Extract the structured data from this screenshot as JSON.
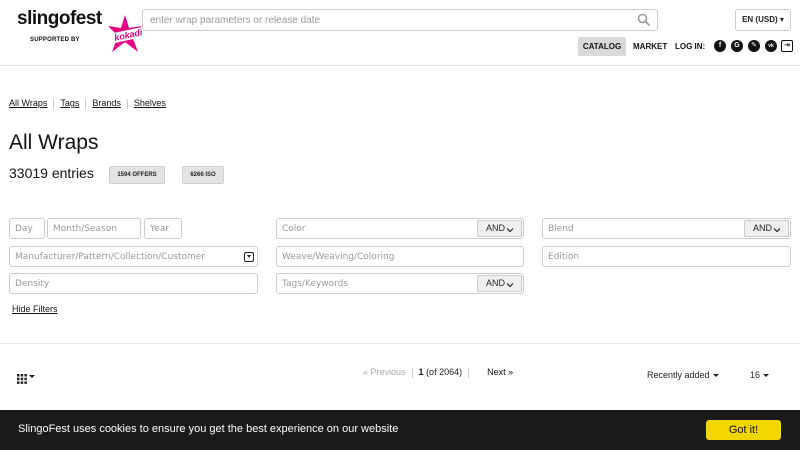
{
  "header": {
    "logo_text": "slingofest",
    "logo_subtitle": "SUPPORTED BY",
    "logo_brand": "kokadi",
    "search_placeholder": "enter wrap parameters or release date",
    "language": "EN (USD) ▾",
    "nav": {
      "catalog": "CATALOG",
      "market": "MARKET",
      "login": "LOG IN:"
    },
    "social_icons": [
      "facebook-icon",
      "google-icon",
      "vk-icon",
      "vk-icon",
      "login-box-icon"
    ],
    "social_glyphs": [
      "f",
      "G",
      "✎",
      "vk",
      "⇥"
    ]
  },
  "breadcrumb": [
    "All Wraps",
    "Tags",
    "Brands",
    "Shelves"
  ],
  "main": {
    "title": "All Wraps",
    "entries": "33019 entries",
    "offers_badge": "1594 OFFERS",
    "iso_badge": "6266 ISO"
  },
  "filters": {
    "day": "Day",
    "month": "Month/Season",
    "year": "Year",
    "manufacturer": "Manufacturer/Pattern/Collection/Customer",
    "density": "Density",
    "color": "Color",
    "weave": "Weave/Weaving/Coloring",
    "tags": "Tags/Keywords",
    "blend": "Blend",
    "edition": "Edition",
    "and_label": "AND",
    "hide_filters": "Hide Filters"
  },
  "pagination": {
    "previous": "« Previous",
    "current": "1",
    "of": "(of 2064)",
    "next": "Next »",
    "sort": "Recently added",
    "per_page": "16"
  },
  "cookie": {
    "text": "SlingoFest uses cookies to ensure you get the best experience on our website",
    "button": "Got it!"
  },
  "colors": {
    "accent": "#e6007e",
    "cookie_button": "#f1d600",
    "cookie_bg": "#1a1a1a"
  }
}
